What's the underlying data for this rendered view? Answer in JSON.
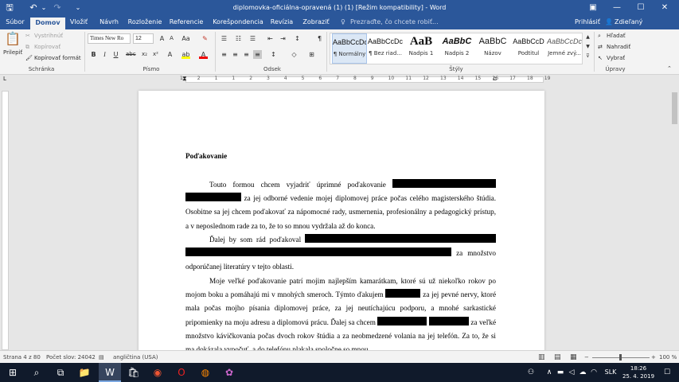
{
  "window": {
    "title": "diplomovka-oficiálna-opravená (1) (1) [Režim kompatibility] - Word"
  },
  "qa": {
    "save": "🖫",
    "undo": "↶",
    "redo": "↷",
    "more": "⌄"
  },
  "wc": {
    "restore": "▣",
    "min": "—",
    "max": "☐",
    "close": "✕"
  },
  "tabs": [
    "Súbor",
    "Domov",
    "Vložiť",
    "Návrh",
    "Rozloženie",
    "Referencie",
    "Korešpondencia",
    "Revízia",
    "Zobraziť"
  ],
  "tell": "Prezraďte, čo chcete robiť...",
  "user": {
    "signin": "Prihlásiť",
    "share": "Zdieľaný prostriedok"
  },
  "clipboard": {
    "paste": "Prilepiť",
    "cut": "Vystrihnúť",
    "copy": "Kopírovať",
    "format": "Kopírovať formát",
    "label": "Schránka"
  },
  "font": {
    "name": "Times New Ro",
    "size": "12",
    "label": "Písmo"
  },
  "paragraph": {
    "label": "Odsek"
  },
  "styles": {
    "label": "Štýly",
    "items": [
      {
        "sample": "AaBbCcDc",
        "name": "¶ Normálny"
      },
      {
        "sample": "AaBbCcDc",
        "name": "¶ Bez riad..."
      },
      {
        "sample": "AaB",
        "name": "Nadpis 1"
      },
      {
        "sample": "AaBbC",
        "name": "Nadpis 2"
      },
      {
        "sample": "AaBbC",
        "name": "Názov"
      },
      {
        "sample": "AaBbCcD",
        "name": "Podtitul"
      },
      {
        "sample": "AaBbCcDc",
        "name": "Jemné zvý..."
      }
    ]
  },
  "editing": {
    "find": "Hľadať",
    "replace": "Nahradiť",
    "select": "Vybrať",
    "label": "Úpravy"
  },
  "ruler": {
    "numbers": [
      "1",
      "2",
      "1",
      "1",
      "2",
      "3",
      "4",
      "5",
      "6",
      "7",
      "8",
      "9",
      "10",
      "11",
      "12",
      "13",
      "14",
      "15",
      "16",
      "17",
      "18",
      "19"
    ]
  },
  "doc": {
    "heading": "Poďakovanie",
    "p1": [
      "Touto formou chcem vyjadriť úprimné poďakovanie",
      "za jej odborné vedenie mojej diplomovej práce počas celého magisterského štúdia. Osobitne sa jej chcem poďakovať za nápomocné rady, usmernenia, profesionálny a pedagogický prístup, a v neposlednom rade za to, že to so mnou vydržala až do konca."
    ],
    "p2": [
      "Ďalej by som rád poďakoval",
      "za množstvo odporúčanej literatúry v tejto oblasti."
    ],
    "p3": [
      "Moje veľké poďakovanie patrí mojim najlepším kamarátkam, ktoré sú už niekoľko rokov po mojom boku a pomáhajú mi v mnohých smeroch. Týmto ďakujem",
      "za jej pevné nervy, ktoré mala počas mojho písania diplomovej práce, za jej neutíchajúcu podporu, a mnohé sarkastické pripomienky na moju adresu a diplomovú prácu. Ďalej sa chcem",
      "za veľké množstvo kávičkovania počas dvoch rokov štúdia a za neobmedzené volania na jej telefón. Za to, že si ma dokázala vypočuť, a do telefónu plakala spoločne so mnou."
    ]
  },
  "status": {
    "page": "Strana 4 z 80",
    "words": "Počet slov: 24042",
    "lang": "angličtina (USA)",
    "zoom": "100 %"
  },
  "taskbar": {
    "time": "18:26",
    "date": "25. 4. 2019",
    "lang": "SLK"
  }
}
